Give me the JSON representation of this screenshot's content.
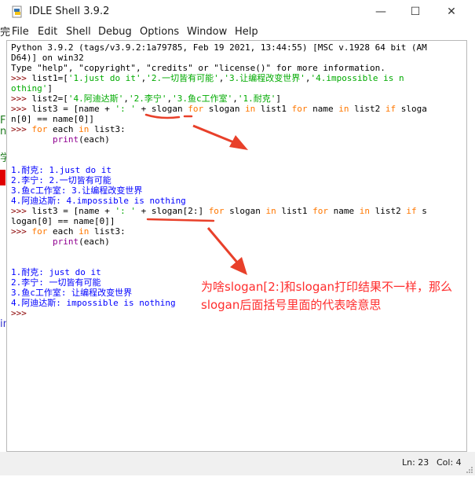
{
  "window": {
    "title": "IDLE Shell 3.9.2",
    "minimize_glyph": "—",
    "maximize_glyph": "☐",
    "close_glyph": "✕",
    "icon": "python-idle-icon"
  },
  "menu": [
    "File",
    "Edit",
    "Shell",
    "Debug",
    "Options",
    "Window",
    "Help"
  ],
  "shell": {
    "banner_1": "Python 3.9.2 (tags/v3.9.2:1a79785, Feb 19 2021, 13:44:55) [MSC v.1928 64 bit (AM",
    "banner_2": "D64)] on win32",
    "banner_3": "Type \"help\", \"copyright\", \"credits\" or \"license()\" for more information.",
    "prompt": ">>> ",
    "l4_code": "list1=[",
    "l4_s1": "'1.just do it'",
    "l4_s2": "'2.一切皆有可能'",
    "l4_s3": "'3.让编程改变世界'",
    "l4_s4": "'4.impossible is n",
    "l5_s4b": "othing'",
    "l5_end": "]",
    "l6_code": "list2=[",
    "l6_s1": "'4.阿迪达斯'",
    "l6_s2": "'2.李宁'",
    "l6_s3": "'3.鱼c工作室'",
    "l6_s4": "'1.耐克'",
    "l6_end": "]",
    "l7_a": "list3 = [name + ",
    "l7_str": "': '",
    "l7_b": " + slogan ",
    "kw_for": "for",
    "l7_c": " slogan ",
    "kw_in": "in",
    "l7_d": " list1 ",
    "l7_e": " name ",
    "l7_f": " list2 ",
    "kw_if": "if",
    "l7_g": " sloga",
    "l8": "n[0] == name[0]]",
    "l9_a": " each ",
    "l9_b": " list3:",
    "l10_indent": "        ",
    "bi_print": "print",
    "l10_rest": "(each)",
    "out1": [
      "1.耐克: 1.just do it",
      "2.李宁: 2.一切皆有可能",
      "3.鱼c工作室: 3.让编程改变世界",
      "4.阿迪达斯: 4.impossible is nothing"
    ],
    "l17_b": " + slogan[2:] ",
    "l17_g": " s",
    "l18": "logan[0] == name[0]]",
    "out2": [
      "1.耐克: just do it",
      "2.李宁: 一切皆有可能",
      "3.鱼c工作室: 让编程改变世界",
      "4.阿迪达斯: impossible is nothing"
    ],
    "last_prompt": ">>>"
  },
  "annotation": {
    "text": "为啥slogan[2:]和slogan打印结果不一样，那么slogan后面括号里面的代表啥意思",
    "color": "#ff2d2d"
  },
  "status": {
    "line": "Ln: 23",
    "col": "Col: 4"
  },
  "left_strip": [
    "完",
    "F",
    "n",
    "学",
    "in",
    "参要"
  ],
  "colors": {
    "keyword": "#ff7700",
    "builtin": "#900090",
    "string": "#00aa00",
    "output": "#0000ff",
    "annotation": "#ff2d2d"
  }
}
